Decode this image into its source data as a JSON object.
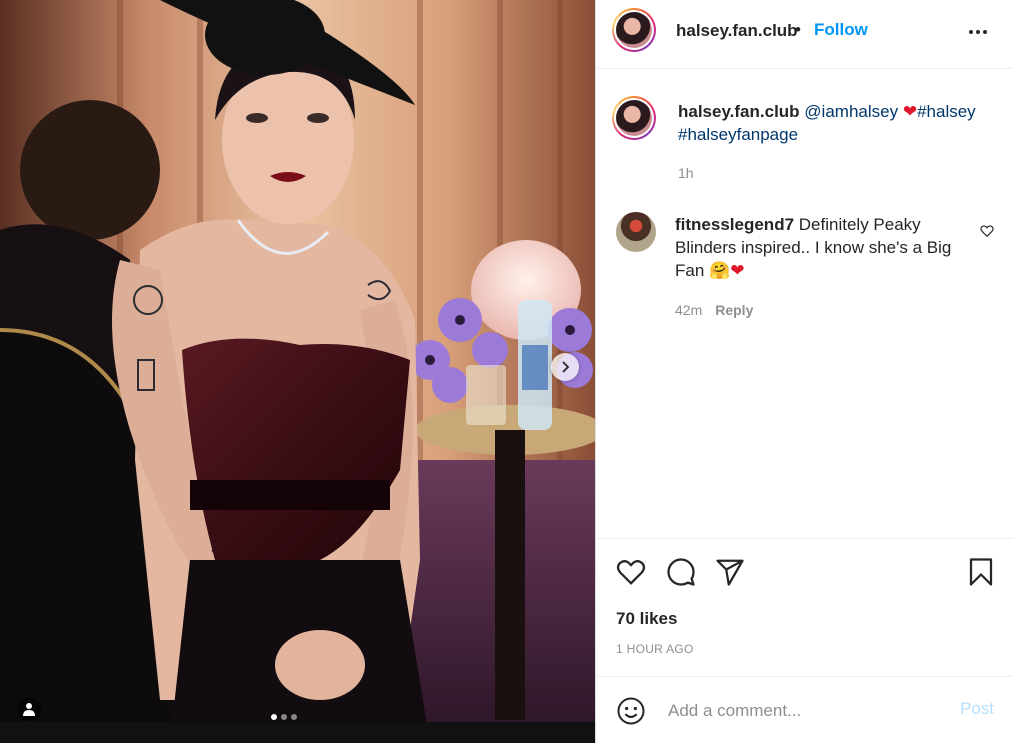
{
  "post": {
    "username": "halsey.fan.club",
    "follow_label": "Follow",
    "separator": "•"
  },
  "caption": {
    "username": "halsey.fan.club",
    "mention": "@iamhalsey",
    "heart": "❤",
    "hashtag1": "#halsey",
    "hashtag2": "#halseyfanpage",
    "time": "1h"
  },
  "comments": [
    {
      "username": "fitnesslegend7",
      "text": "Definitely Peaky Blinders inspired.. I know she's a Big Fan",
      "emoji1": "🤗",
      "emoji2": "❤",
      "time": "42m",
      "reply_label": "Reply"
    }
  ],
  "stats": {
    "likes": "70 likes",
    "posted_ago": "1 HOUR AGO"
  },
  "compose": {
    "placeholder": "Add a comment...",
    "post_label": "Post"
  },
  "carousel": {
    "slide_count": 3,
    "active_index": 0
  },
  "colors": {
    "accent": "#0095f6",
    "link": "#00376b",
    "muted": "#8e8e8e",
    "post_disabled": "#b2dffc"
  },
  "icons": [
    "user-tag-icon",
    "chevron-right-icon",
    "more-icon",
    "heart-icon",
    "comment-icon",
    "share-icon",
    "bookmark-icon",
    "emoji-icon"
  ]
}
